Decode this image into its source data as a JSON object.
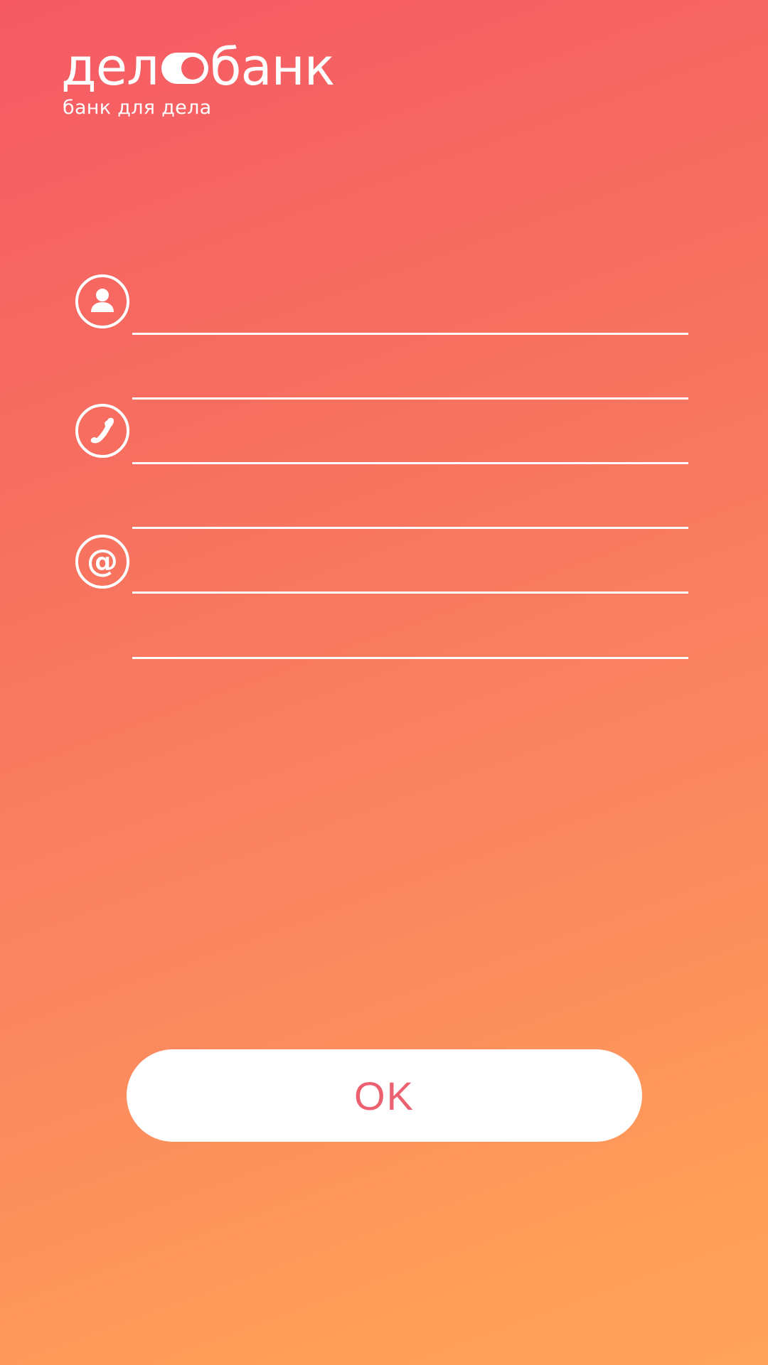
{
  "logo": {
    "word_left": "дел",
    "word_right": "банк",
    "tagline": "банк для дела"
  },
  "form": {
    "fields": [
      {
        "name": "name-field-1",
        "icon": "user-icon",
        "value": "",
        "placeholder": ""
      },
      {
        "name": "name-field-2",
        "value": "",
        "placeholder": ""
      },
      {
        "name": "phone-field-1",
        "icon": "phone-icon",
        "value": "",
        "placeholder": ""
      },
      {
        "name": "phone-field-2",
        "value": "",
        "placeholder": ""
      },
      {
        "name": "email-field-1",
        "icon": "at-sign-icon",
        "value": "",
        "placeholder": ""
      },
      {
        "name": "email-field-2",
        "value": "",
        "placeholder": ""
      }
    ]
  },
  "ok_button": {
    "label": "OK"
  },
  "colors": {
    "gradient_top": "#f55a65",
    "gradient_bottom": "#ffa25a",
    "button_text": "#ec6170",
    "foreground": "#ffffff"
  }
}
